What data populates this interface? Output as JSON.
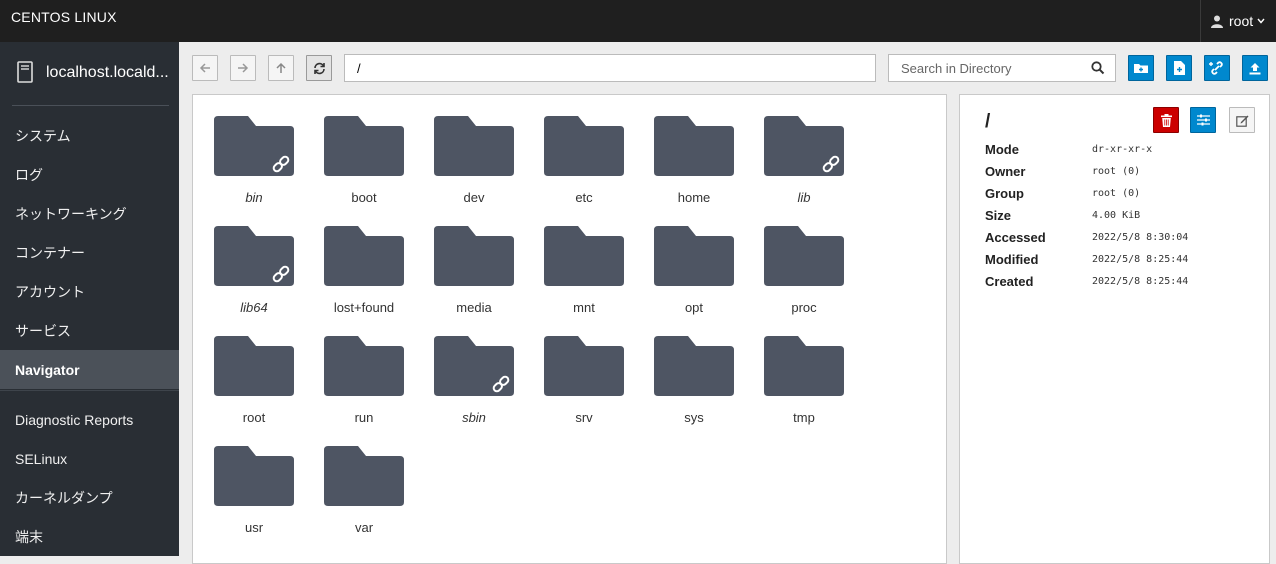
{
  "topbar": {
    "brand": "CENTOS LINUX",
    "user": "root"
  },
  "sidebar": {
    "host": "localhost.locald...",
    "items": [
      {
        "label": "システム"
      },
      {
        "label": "ログ"
      },
      {
        "label": "ネットワーキング"
      },
      {
        "label": "コンテナー"
      },
      {
        "label": "アカウント"
      },
      {
        "label": "サービス"
      },
      {
        "label": "Navigator",
        "active": true
      },
      {
        "label": "Diagnostic Reports"
      },
      {
        "label": "SELinux"
      },
      {
        "label": "カーネルダンプ"
      },
      {
        "label": "端末"
      }
    ]
  },
  "toolbar": {
    "path": "/",
    "search_placeholder": "Search in Directory"
  },
  "files": [
    {
      "name": "bin",
      "link": true
    },
    {
      "name": "boot",
      "link": false
    },
    {
      "name": "dev",
      "link": false
    },
    {
      "name": "etc",
      "link": false
    },
    {
      "name": "home",
      "link": false
    },
    {
      "name": "lib",
      "link": true
    },
    {
      "name": "lib64",
      "link": true
    },
    {
      "name": "lost+found",
      "link": false
    },
    {
      "name": "media",
      "link": false
    },
    {
      "name": "mnt",
      "link": false
    },
    {
      "name": "opt",
      "link": false
    },
    {
      "name": "proc",
      "link": false
    },
    {
      "name": "root",
      "link": false
    },
    {
      "name": "run",
      "link": false
    },
    {
      "name": "sbin",
      "link": true
    },
    {
      "name": "srv",
      "link": false
    },
    {
      "name": "sys",
      "link": false
    },
    {
      "name": "tmp",
      "link": false
    },
    {
      "name": "usr",
      "link": false
    },
    {
      "name": "var",
      "link": false
    }
  ],
  "info": {
    "title": "/",
    "properties": [
      {
        "label": "Mode",
        "value": "dr-xr-xr-x"
      },
      {
        "label": "Owner",
        "value": "root (0)"
      },
      {
        "label": "Group",
        "value": "root (0)"
      },
      {
        "label": "Size",
        "value": "4.00 KiB"
      },
      {
        "label": "Accessed",
        "value": "2022/5/8 8:30:04"
      },
      {
        "label": "Modified",
        "value": "2022/5/8 8:25:44"
      },
      {
        "label": "Created",
        "value": "2022/5/8 8:25:44"
      }
    ]
  },
  "colors": {
    "topbar": "#1f1f1f",
    "sidebar": "#292e34",
    "sidebar_active": "#4b5159",
    "folder": "#4e5563",
    "primary": "#0088ce",
    "danger": "#cc0000"
  }
}
